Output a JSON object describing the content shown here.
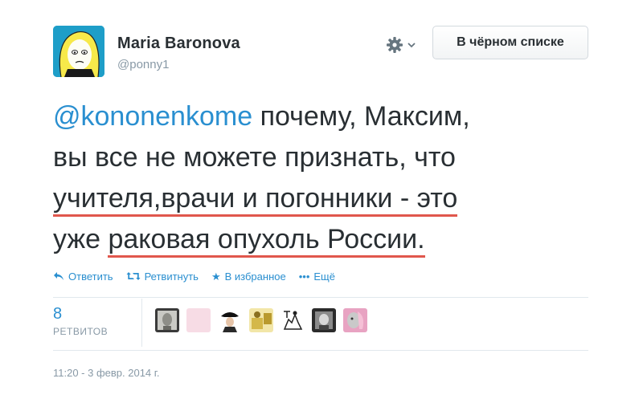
{
  "author": {
    "name": "Maria Baronova",
    "handle": "@ponny1"
  },
  "header": {
    "blocked_label": "В чёрном списке"
  },
  "tweet": {
    "mention": "@kononenkome",
    "line1_rest": " почему, Максим,",
    "line2": "вы все не можете признать, что",
    "line3": "учителя,врачи и погонники - это",
    "line4_pre": "уже ",
    "line4_underlined": "раковая опухоль России."
  },
  "actions": {
    "reply": "Ответить",
    "retweet": "Ретвитнуть",
    "favorite": "В избранное",
    "more": "Ещё"
  },
  "stats": {
    "retweet_count": "8",
    "retweet_label": "РЕТВИТОВ"
  },
  "timestamp": "11:20 - 3 февр. 2014 г.",
  "colors": {
    "link": "#2a8fd0",
    "text": "#292f33",
    "muted": "#8899a6",
    "underline": "#e0574d",
    "avatar_bg": "#1e9ec8"
  }
}
